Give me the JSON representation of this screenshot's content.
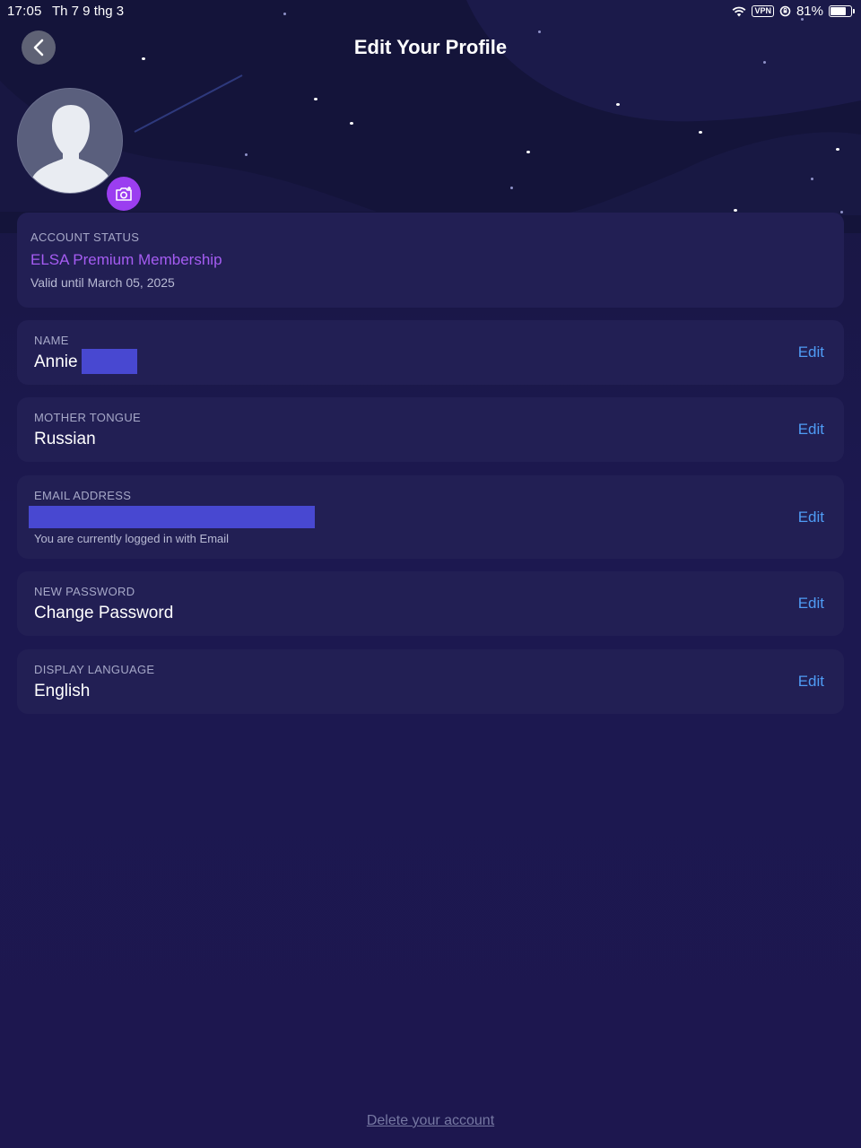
{
  "status_bar": {
    "time": "17:05",
    "date": "Th 7 9 thg 3",
    "vpn": "VPN",
    "battery": "81%",
    "battery_level": 0.81
  },
  "header": {
    "title": "Edit Your Profile",
    "back_icon": "chevron-left-icon"
  },
  "avatar": {
    "icon": "user-silhouette-icon",
    "camera_icon": "camera-icon"
  },
  "account_status": {
    "label": "ACCOUNT STATUS",
    "plan": "ELSA Premium Membership",
    "valid_until": "Valid until March 05, 2025"
  },
  "fields": {
    "name": {
      "label": "NAME",
      "value": "Annie",
      "edit": "Edit"
    },
    "mother_tongue": {
      "label": "MOTHER TONGUE",
      "value": "Russian",
      "edit": "Edit"
    },
    "email": {
      "label": "EMAIL ADDRESS",
      "value": "",
      "note": "You are currently logged in with Email",
      "edit": "Edit"
    },
    "password": {
      "label": "NEW PASSWORD",
      "value": "Change Password",
      "edit": "Edit"
    },
    "display_language": {
      "label": "DISPLAY LANGUAGE",
      "value": "English",
      "edit": "Edit"
    }
  },
  "footer": {
    "delete_account": "Delete your account"
  },
  "colors": {
    "accent_purple": "#a55cf2",
    "link_blue": "#4f9cf5",
    "card_bg": "#221f54",
    "redaction": "#4848d1"
  }
}
